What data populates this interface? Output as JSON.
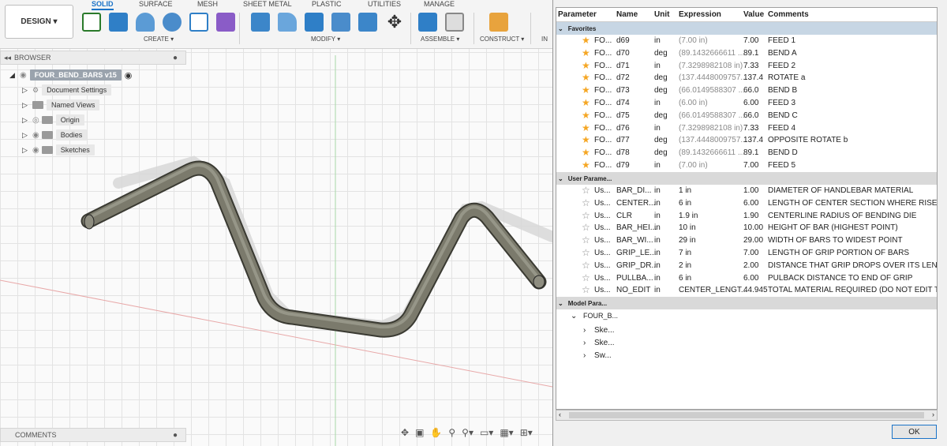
{
  "toolbar": {
    "design_label": "DESIGN ▾",
    "tabs": [
      "SOLID",
      "SURFACE",
      "MESH",
      "SHEET METAL",
      "PLASTIC",
      "UTILITIES",
      "MANAGE"
    ],
    "groups": [
      "CREATE ▾",
      "MODIFY ▾",
      "ASSEMBLE ▾",
      "CONSTRUCT ▾",
      "IN"
    ]
  },
  "browser": {
    "header": "BROWSER",
    "root": "FOUR_BEND_BARS v15",
    "items": [
      "Document Settings",
      "Named Views",
      "Origin",
      "Bodies",
      "Sketches"
    ]
  },
  "comments": {
    "header": "COMMENTS"
  },
  "params": {
    "columns": [
      "Parameter",
      "Name",
      "Unit",
      "Expression",
      "Value",
      "Comments"
    ],
    "sections": {
      "favorites": "Favorites",
      "user": "User Parame...",
      "model": "Model Para..."
    },
    "favorites": [
      {
        "param": "FO...",
        "name": "d69",
        "unit": "in",
        "expr": "(7.00 in)",
        "value": "7.00",
        "comment": "FEED 1"
      },
      {
        "param": "FO...",
        "name": "d70",
        "unit": "deg",
        "expr": "(89.1432666611 ...",
        "value": "89.1",
        "comment": "BEND A"
      },
      {
        "param": "FO...",
        "name": "d71",
        "unit": "in",
        "expr": "(7.3298982108 in)",
        "value": "7.33",
        "comment": "FEED 2"
      },
      {
        "param": "FO...",
        "name": "d72",
        "unit": "deg",
        "expr": "(137.4448009757...",
        "value": "137.4",
        "comment": "ROTATE a"
      },
      {
        "param": "FO...",
        "name": "d73",
        "unit": "deg",
        "expr": "(66.0149588307 ...",
        "value": "66.0",
        "comment": "BEND B"
      },
      {
        "param": "FO...",
        "name": "d74",
        "unit": "in",
        "expr": "(6.00 in)",
        "value": "6.00",
        "comment": "FEED 3"
      },
      {
        "param": "FO...",
        "name": "d75",
        "unit": "deg",
        "expr": "(66.0149588307 ...",
        "value": "66.0",
        "comment": "BEND C"
      },
      {
        "param": "FO...",
        "name": "d76",
        "unit": "in",
        "expr": "(7.3298982108 in)",
        "value": "7.33",
        "comment": "FEED 4"
      },
      {
        "param": "FO...",
        "name": "d77",
        "unit": "deg",
        "expr": "(137.4448009757...",
        "value": "137.4",
        "comment": "OPPOSITE ROTATE b"
      },
      {
        "param": "FO...",
        "name": "d78",
        "unit": "deg",
        "expr": "(89.1432666611 ...",
        "value": "89.1",
        "comment": "BEND D"
      },
      {
        "param": "FO...",
        "name": "d79",
        "unit": "in",
        "expr": "(7.00 in)",
        "value": "7.00",
        "comment": "FEED 5"
      }
    ],
    "user": [
      {
        "param": "Us...",
        "name": "BAR_DI...",
        "unit": "in",
        "expr": "1 in",
        "value": "1.00",
        "comment": "DIAMETER OF HANDLEBAR MATERIAL"
      },
      {
        "param": "Us...",
        "name": "CENTER...",
        "unit": "in",
        "expr": "6 in",
        "value": "6.00",
        "comment": "LENGTH OF CENTER SECTION WHERE RISER GRIPS ("
      },
      {
        "param": "Us...",
        "name": "CLR",
        "unit": "in",
        "expr": "1.9 in",
        "value": "1.90",
        "comment": "CENTERLINE RADIUS OF BENDING DIE"
      },
      {
        "param": "Us...",
        "name": "BAR_HEI...",
        "unit": "in",
        "expr": "10 in",
        "value": "10.00",
        "comment": "HEIGHT OF BAR (HIGHEST POINT)"
      },
      {
        "param": "Us...",
        "name": "BAR_WI...",
        "unit": "in",
        "expr": "29 in",
        "value": "29.00",
        "comment": "WIDTH OF BARS TO WIDEST POINT"
      },
      {
        "param": "Us...",
        "name": "GRIP_LE...",
        "unit": "in",
        "expr": "7 in",
        "value": "7.00",
        "comment": "LENGTH OF GRIP PORTION OF BARS"
      },
      {
        "param": "Us...",
        "name": "GRIP_DR...",
        "unit": "in",
        "expr": "2 in",
        "value": "2.00",
        "comment": "DISTANCE THAT GRIP DROPS OVER ITS LENGTH"
      },
      {
        "param": "Us...",
        "name": "PULLBA...",
        "unit": "in",
        "expr": "6 in",
        "value": "6.00",
        "comment": "PULBACK DISTANCE TO END OF GRIP"
      },
      {
        "param": "Us...",
        "name": "NO_EDIT",
        "unit": "in",
        "expr": "CENTER_LENGT...",
        "value": "44.945",
        "comment": "TOTAL MATERIAL REQUIRED (DO NOT EDIT THIS ROV"
      }
    ],
    "model_root": "FOUR_B...",
    "model_children": [
      "Ske...",
      "Ske...",
      "Sw..."
    ]
  },
  "ok_label": "OK"
}
